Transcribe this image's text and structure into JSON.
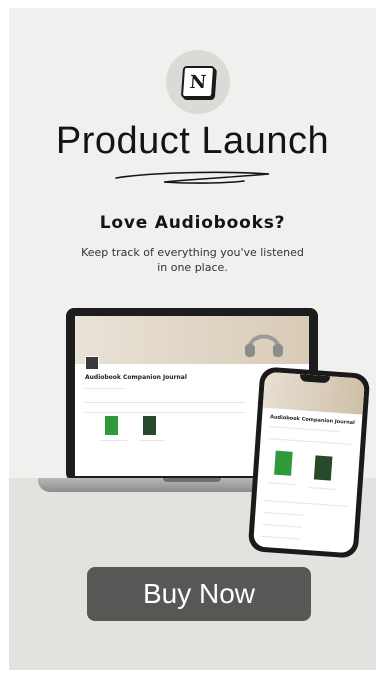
{
  "header": {
    "logo_icon": "notion-logo-icon",
    "logo_glyph": "N",
    "title": "Product Launch"
  },
  "promo": {
    "headline": "Love Audiobooks?",
    "description": "Keep track of everything you've listened in one place."
  },
  "mockup": {
    "laptop_page_title": "Audiobook Companion Journal",
    "phone_page_title": "Audiobook Companion Journal"
  },
  "cta": {
    "label": "Buy Now"
  },
  "colors": {
    "background": "#f1f0ee",
    "button": "#585756",
    "text": "#141414"
  }
}
